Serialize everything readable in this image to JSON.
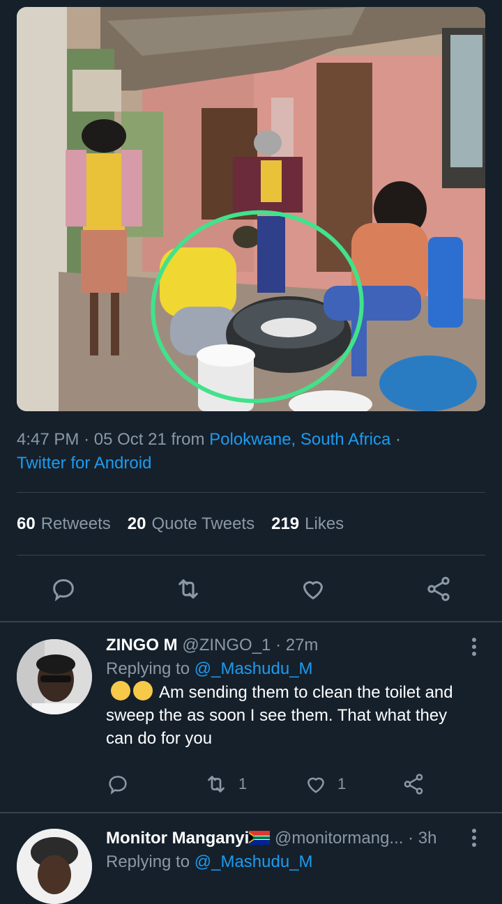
{
  "tweet": {
    "photo": {
      "description_icon": "photo-image"
    },
    "time": "4:47 PM",
    "date": "05 Oct 21",
    "from_word": "from",
    "location": "Polokwane, South Africa",
    "source": "Twitter for Android",
    "separator": "·",
    "stats": {
      "retweets_count": "60",
      "retweets_label": "Retweets",
      "quotes_count": "20",
      "quotes_label": "Quote Tweets",
      "likes_count": "219",
      "likes_label": "Likes"
    },
    "actions": [
      "reply-icon",
      "retweet-icon",
      "like-icon",
      "share-icon"
    ]
  },
  "replies": [
    {
      "name": "ZINGO M",
      "handle": "@ZINGO_1",
      "time": "27m",
      "replying_label": "Replying to",
      "replying_to": "@_Mashudu_M",
      "text": "Am sending them to clean the toilet and sweep the as soon I see them. That what they can do for you",
      "emoji": "😂😂",
      "retweets": "1",
      "likes": "1"
    },
    {
      "name": "Monitor Manganyi",
      "handle": "@monitormang...",
      "time": "3h",
      "replying_label": "Replying to",
      "replying_to": "@_Mashudu_M",
      "flag": "south-africa-flag"
    }
  ],
  "colors": {
    "background": "#15202b",
    "link": "#1d9bf0",
    "muted": "#8b98a5",
    "divider": "#38444d"
  }
}
